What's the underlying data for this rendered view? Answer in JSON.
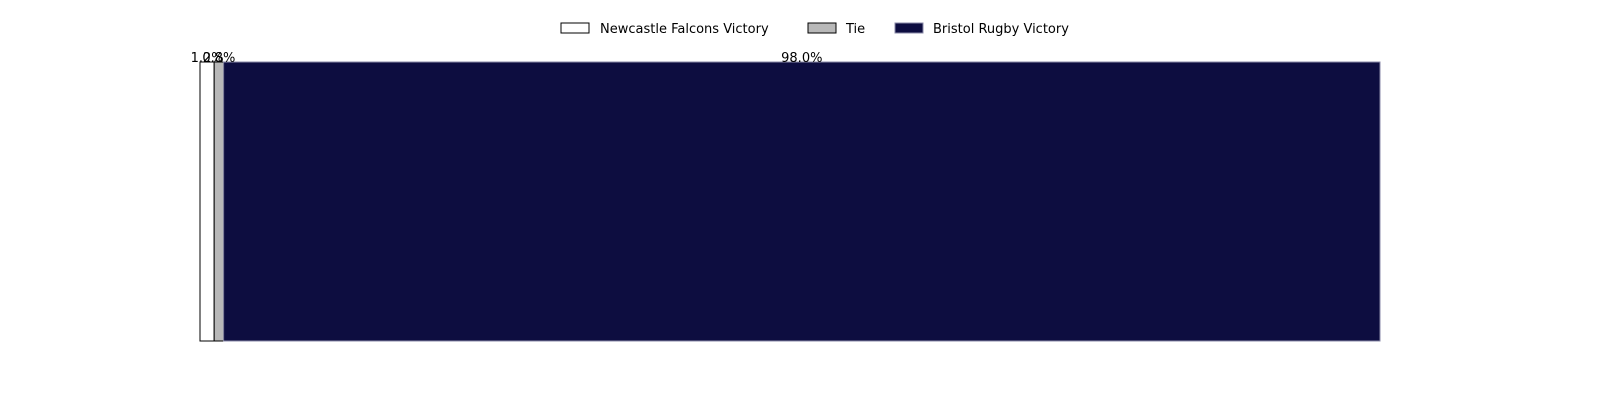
{
  "chart_data": {
    "type": "bar",
    "orientation": "horizontal-stacked",
    "title": "",
    "xlabel": "",
    "ylabel": "",
    "axes_visible": false,
    "grid": false,
    "legend_position": "top-center",
    "xlim": [
      0,
      100
    ],
    "series": [
      {
        "name": "Newcastle Falcons Victory",
        "value": 1.2,
        "label": "1.2%",
        "color": "#ffffff",
        "edge": "#000000"
      },
      {
        "name": "Tie",
        "value": 0.8,
        "label": "0.8%",
        "color": "#b8b8b8",
        "edge": "#000000"
      },
      {
        "name": "Bristol Rugby Victory",
        "value": 98.0,
        "label": "98.0%",
        "color": "#0d0d40",
        "edge": "#8a8aa8"
      }
    ]
  }
}
